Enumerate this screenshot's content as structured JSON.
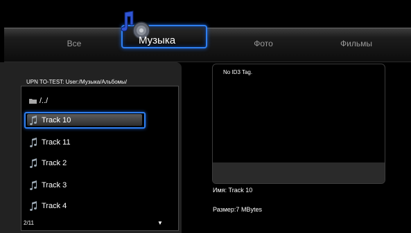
{
  "tabs": {
    "all": "Все",
    "music": "Музыка",
    "photo": "Фото",
    "films": "Фильмы"
  },
  "browser": {
    "path": "UPN TO-TEST: User:/Музыка/Альбомы/",
    "items": [
      {
        "label": "/../",
        "icon": "folder-icon"
      },
      {
        "label": "Track 10",
        "icon": "music-note-icon"
      },
      {
        "label": "Track 11",
        "icon": "music-note-icon"
      },
      {
        "label": "Track 2",
        "icon": "music-note-icon"
      },
      {
        "label": "Track 3",
        "icon": "music-note-icon"
      },
      {
        "label": "Track 4",
        "icon": "music-note-icon"
      }
    ],
    "selected_index": 1,
    "page_count": "2/11",
    "scroll_indicator": "▼"
  },
  "info": {
    "id3": "No ID3 Tag.",
    "name": "Имя: Track 10",
    "size": "Размер:7 MBytes"
  },
  "colors": {
    "accent": "#2e7ff0",
    "note_icon": "#9aa7b2",
    "folder_icon": "#a7a7a7"
  }
}
